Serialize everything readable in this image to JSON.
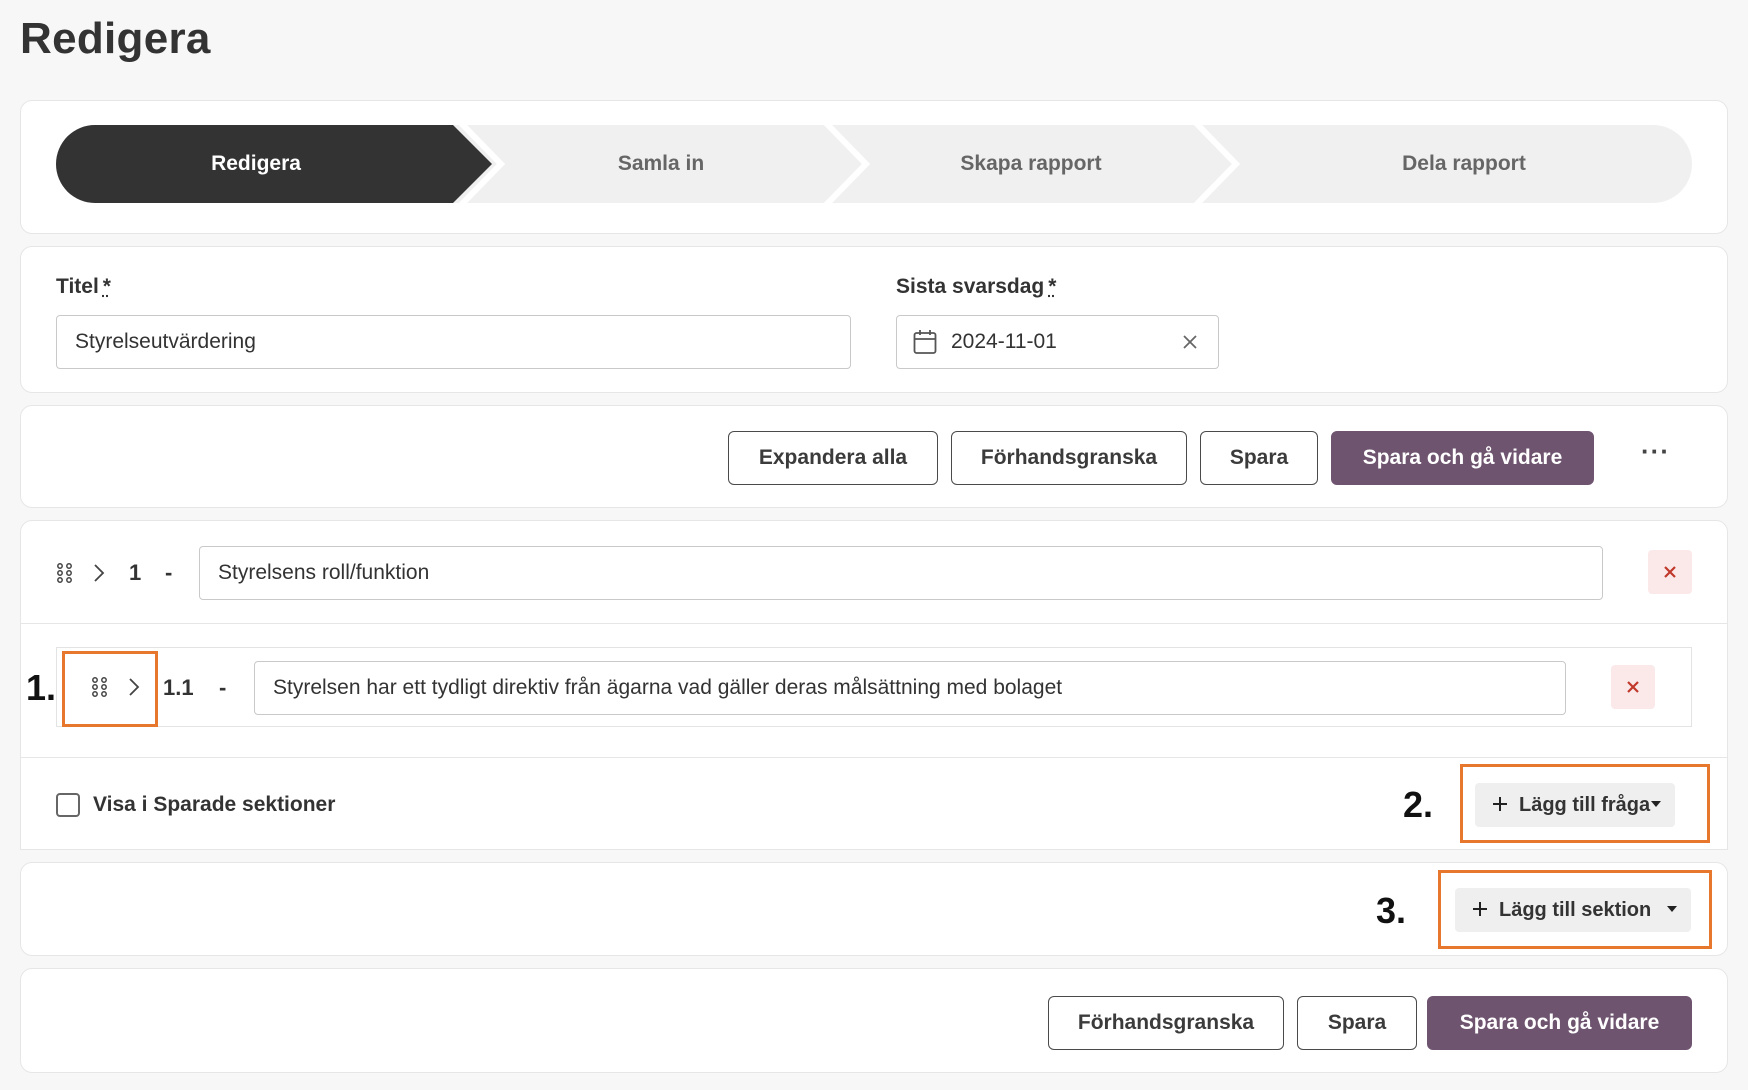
{
  "page": {
    "title": "Redigera"
  },
  "stepper": {
    "steps": [
      {
        "label": "Redigera",
        "active": true
      },
      {
        "label": "Samla in",
        "active": false
      },
      {
        "label": "Skapa rapport",
        "active": false
      },
      {
        "label": "Dela rapport",
        "active": false
      }
    ],
    "active_color": "#333333"
  },
  "form": {
    "title_label": "Titel",
    "title_required": "*",
    "title_value": "Styrelseutvärdering",
    "deadline_label": "Sista svarsdag",
    "deadline_required": "*",
    "deadline_value": "2024-11-01"
  },
  "toolbar": {
    "expand_all": "Expandera alla",
    "preview": "Förhandsgranska",
    "save": "Spara",
    "save_continue": "Spara och gå vidare",
    "more": "···",
    "primary_color": "#6f5470"
  },
  "section": {
    "number": "1",
    "separator": "-",
    "title_value": "Styrelsens roll/funktion",
    "questions": [
      {
        "number": "1.1",
        "separator": "-",
        "text": "Styrelsen har ett tydligt direktiv från ägarna vad gäller deras målsättning med bolaget"
      }
    ],
    "show_saved_label": "Visa i Sparade sektioner",
    "add_question": "Lägg till fråga"
  },
  "add_section": {
    "label": "Lägg till sektion"
  },
  "bottom": {
    "preview": "Förhandsgranska",
    "save": "Spara",
    "save_continue": "Spara och gå vidare"
  },
  "annotations": {
    "one": "1.",
    "two": "2.",
    "three": "3.",
    "color": "#e8772e"
  }
}
